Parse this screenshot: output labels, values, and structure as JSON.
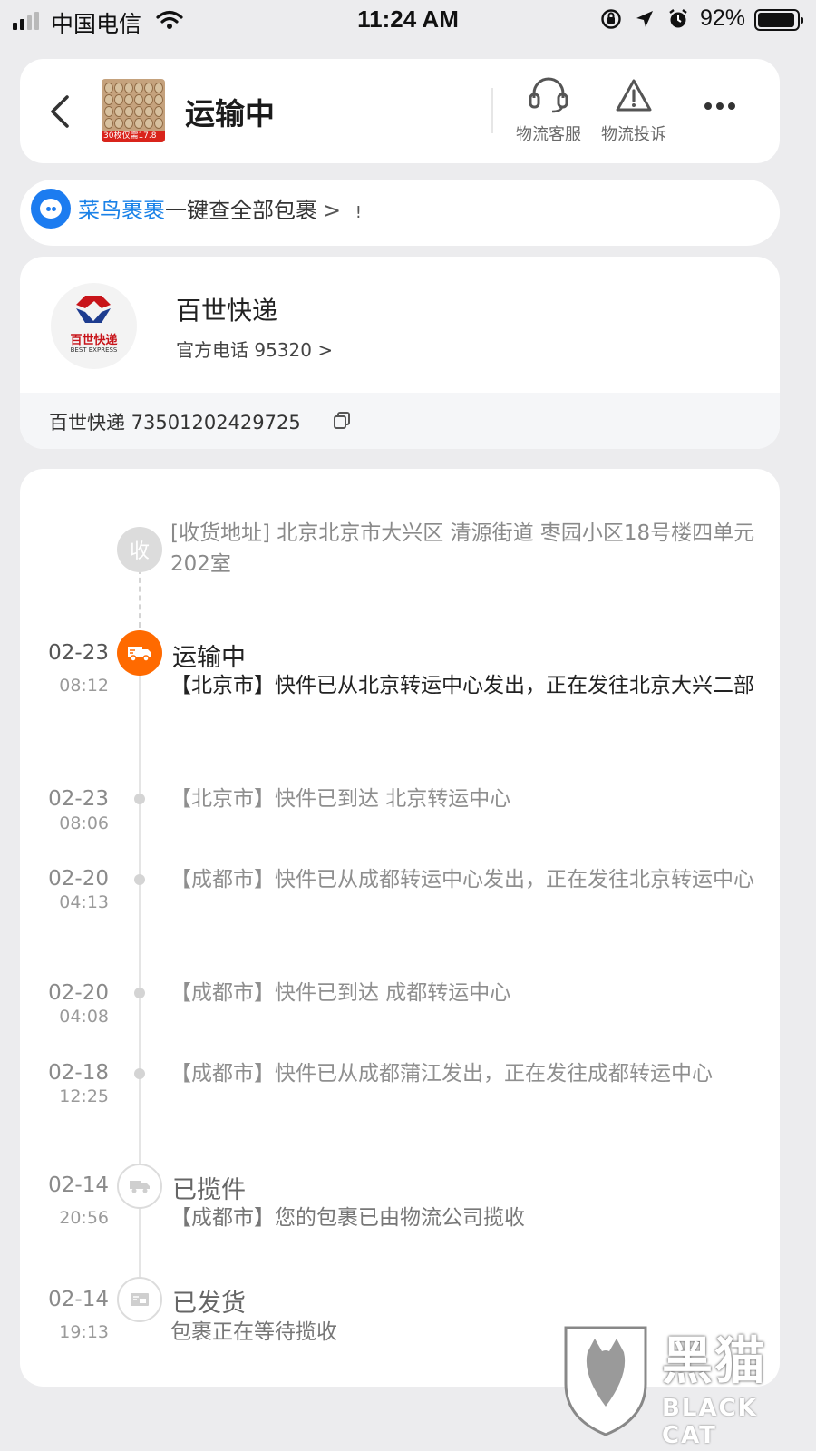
{
  "status_bar": {
    "carrier": "中国电信",
    "time": "11:24 AM",
    "battery": "92%",
    "battery_level": 0.92
  },
  "header": {
    "back_icon": "chevron-left-icon",
    "product_thumbnail_tag": "30枚仅需17.8",
    "status_title": "运输中",
    "service_label": "物流客服",
    "complaint_label": "物流投诉",
    "service_icon": "headset-icon",
    "complaint_icon": "warning-triangle-icon",
    "more_icon": "more-dots-icon"
  },
  "cainiao": {
    "brand": "菜鸟裹裹",
    "text": "一键查全部包裹",
    "arrow": ">",
    "suffix": "!"
  },
  "courier": {
    "logo_cn": "百世快递",
    "logo_en": "BEST EXPRESS",
    "name": "百世快递",
    "phone": "官方电话 95320 >",
    "tracking": "百世快递 73501202429725",
    "brand_color": "#c8141a"
  },
  "timeline": {
    "address_badge": "收",
    "address": "[收货地址] 北京北京市大兴区  清源街道   枣园小区18号楼四单元202室",
    "events": [
      {
        "date": "02-23",
        "time": "08:12",
        "title": "运输中",
        "text": "【北京市】快件已从北京转运中心发出，正在发往北京大兴二部"
      },
      {
        "date": "02-23",
        "time": "08:06",
        "title": "",
        "text": "【北京市】快件已到达 北京转运中心"
      },
      {
        "date": "02-20",
        "time": "04:13",
        "title": "",
        "text": "【成都市】快件已从成都转运中心发出，正在发往北京转运中心"
      },
      {
        "date": "02-20",
        "time": "04:08",
        "title": "",
        "text": "【成都市】快件已到达 成都转运中心"
      },
      {
        "date": "02-18",
        "time": "12:25",
        "title": "",
        "text": "【成都市】快件已从成都蒲江发出，正在发往成都转运中心"
      },
      {
        "date": "02-14",
        "time": "20:56",
        "title": "已揽件",
        "text": "【成都市】您的包裹已由物流公司揽收"
      },
      {
        "date": "02-14",
        "time": "19:13",
        "title": "已发货",
        "text": "包裹正在等待揽收"
      }
    ],
    "active_color": "#ff6a00"
  },
  "watermark": {
    "cn": "黑猫",
    "en": "BLACK CAT"
  }
}
